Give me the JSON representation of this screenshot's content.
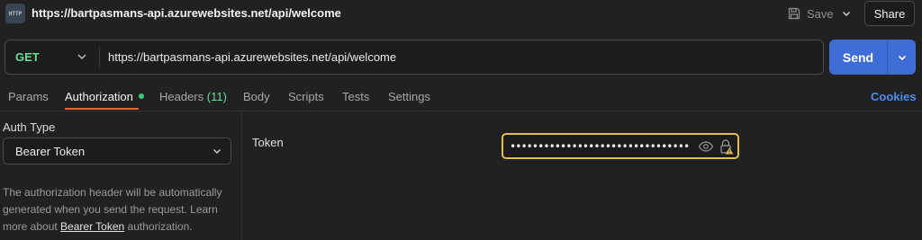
{
  "header": {
    "request_title": "https://bartpasmans-api.azurewebsites.net/api/welcome",
    "icon_text": "HTTP",
    "save_label": "Save",
    "share_label": "Share"
  },
  "request": {
    "method": "GET",
    "url": "https://bartpasmans-api.azurewebsites.net/api/welcome",
    "send_label": "Send"
  },
  "tabs": {
    "params": "Params",
    "authorization": "Authorization",
    "headers": "Headers",
    "headers_count": "(11)",
    "body": "Body",
    "scripts": "Scripts",
    "tests": "Tests",
    "settings": "Settings",
    "cookies": "Cookies"
  },
  "auth": {
    "type_label": "Auth Type",
    "type_value": "Bearer Token",
    "help_prefix": "The authorization header will be automatically generated when you send the request. Learn more about ",
    "help_link": "Bearer Token",
    "help_suffix": " authorization.",
    "token_label": "Token",
    "token_value": "••••••••••••••••••••••••••••••••"
  },
  "colors": {
    "accent_send": "#3e6dd6",
    "method_get": "#6bdd9a",
    "active_tab_underline": "#e2663e",
    "token_border_warning": "#e0c04a",
    "cookies_link": "#4f8cf0"
  },
  "icons": {
    "app": "http-icon",
    "save": "save-icon",
    "eye": "eye-icon",
    "lock_warning": "lock-warning-icon"
  }
}
